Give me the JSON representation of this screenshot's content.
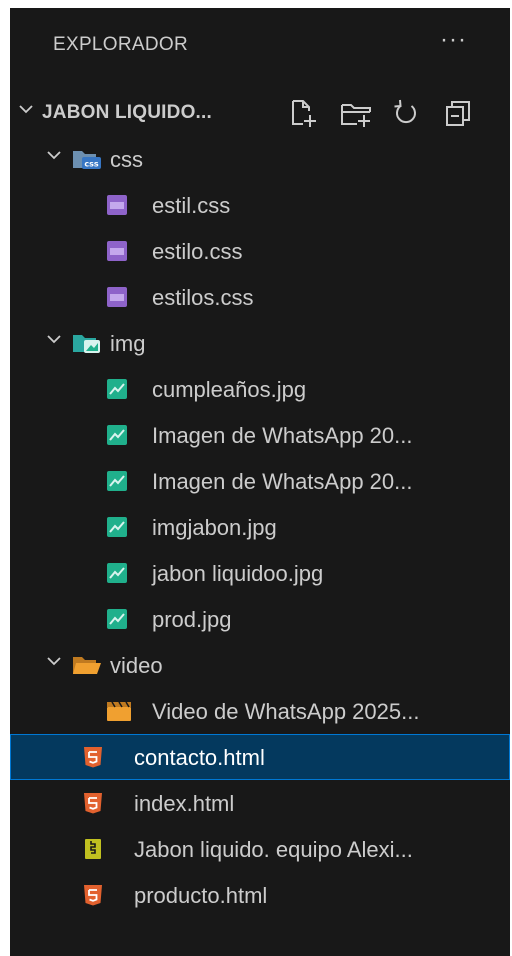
{
  "explorer": {
    "title": "EXPLORADOR",
    "more": "···",
    "project": "JABON LIQUIDO..."
  },
  "tree": {
    "css_folder": "css",
    "estil": "estil.css",
    "estilo": "estilo.css",
    "estilos": "estilos.css",
    "img_folder": "img",
    "cumple": "cumpleaños.jpg",
    "whatsapp1": "Imagen de WhatsApp 20...",
    "whatsapp2": "Imagen de WhatsApp 20...",
    "imgjabon": "imgjabon.jpg",
    "jabonliquidoo": "jabon liquidoo.jpg",
    "prod": "prod.jpg",
    "video_folder": "video",
    "video_file": "Video de WhatsApp 2025...",
    "contacto": "contacto.html",
    "index": "index.html",
    "jabon_doc": "Jabon liquido. equipo Alexi...",
    "producto": "producto.html"
  },
  "colors": {
    "background": "#181818",
    "text": "#cccccc",
    "selection": "#04395e",
    "selection_border": "#0078d4",
    "css_icon": "#8e63c9",
    "image_icon": "#20b08c",
    "html_icon": "#e2612e",
    "folder_icon": "#f0a030",
    "doc_icon": "#c0c020"
  }
}
